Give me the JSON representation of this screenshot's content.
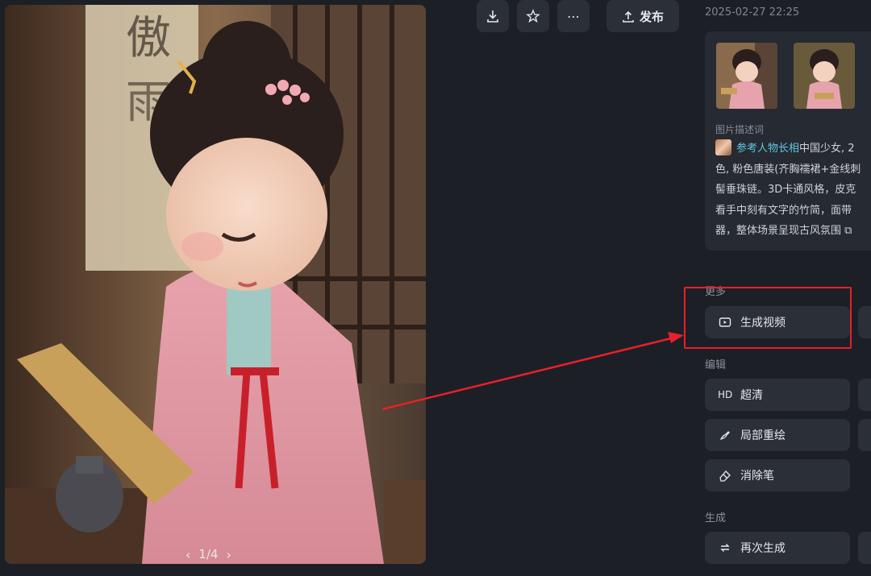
{
  "viewer": {
    "page_indicator": "1/4",
    "icons": {
      "prev": "chevron-left-icon",
      "next": "chevron-right-icon"
    }
  },
  "toolbar": {
    "publish_label": "发布",
    "icons": [
      "download-icon",
      "star-icon",
      "more-icon",
      "upload-icon"
    ]
  },
  "details": {
    "timestamp": "2025-02-27 22:25",
    "description_label": "图片描述词",
    "description": {
      "reference_label": "参考人物长相",
      "lines": [
        "中国少女, 2",
        "色, 粉色唐装(齐胸襦裙+金线刺",
        "髻垂珠链。3D卡通风格，皮克",
        "看手中刻有文字的竹简，面带",
        "器，整体场景呈现古风氛围 ⧉"
      ]
    }
  },
  "sections": {
    "more": {
      "label": "更多",
      "buttons": [
        "生成视频"
      ]
    },
    "edit": {
      "label": "编辑",
      "buttons": [
        "超清",
        "局部重绘",
        "消除笔"
      ]
    },
    "generate": {
      "label": "生成",
      "buttons": [
        "再次生成"
      ]
    }
  },
  "edit_icons": {
    "hd_text": "HD"
  },
  "colors": {
    "background": "#1c1f26",
    "button": "#2b2f38",
    "highlight": "#e8202a",
    "link": "#5ec8e5"
  }
}
